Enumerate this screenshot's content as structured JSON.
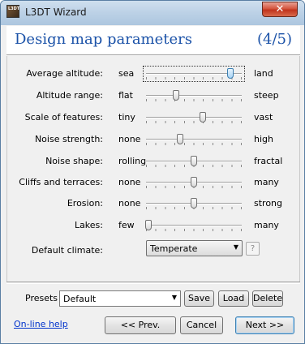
{
  "window": {
    "title": "L3DT Wizard",
    "icon": "l3dt-app-icon",
    "icon_text": "L3DT",
    "close_glyph": "✕"
  },
  "header": {
    "heading": "Design map parameters",
    "step": "(4/5)"
  },
  "params": [
    {
      "label": "Average altitude:",
      "left": "sea",
      "right": "land",
      "value": 0.9,
      "focused": true
    },
    {
      "label": "Altitude range:",
      "left": "flat",
      "right": "steep",
      "value": 0.3
    },
    {
      "label": "Scale of features:",
      "left": "tiny",
      "right": "vast",
      "value": 0.6
    },
    {
      "label": "Noise strength:",
      "left": "none",
      "right": "high",
      "value": 0.35
    },
    {
      "label": "Noise shape:",
      "left": "rolling",
      "right": "fractal",
      "value": 0.5
    },
    {
      "label": "Cliffs and terraces:",
      "left": "none",
      "right": "many",
      "value": 0.5
    },
    {
      "label": "Erosion:",
      "left": "none",
      "right": "strong",
      "value": 0.5
    },
    {
      "label": "Lakes:",
      "left": "few",
      "right": "many",
      "value": 0.0
    }
  ],
  "climate": {
    "label": "Default climate:",
    "value": "Temperate",
    "help": "?"
  },
  "presets": {
    "label": "Presets",
    "value": "Default",
    "save": "Save",
    "load": "Load",
    "delete": "Delete"
  },
  "footer": {
    "help_link": "On-line help",
    "prev": "<< Prev.",
    "cancel": "Cancel",
    "next": "Next >>"
  },
  "colors": {
    "accent": "#1b52a8",
    "link": "#0033cc",
    "close": "#c0341d"
  }
}
